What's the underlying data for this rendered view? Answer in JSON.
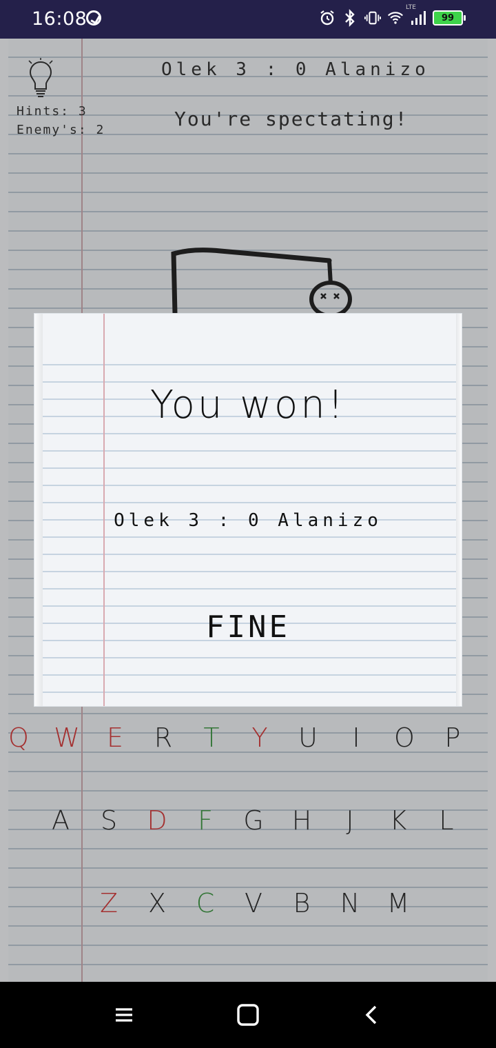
{
  "status_bar": {
    "time": "16:08",
    "network_label": "LTE",
    "battery_level": "99",
    "icons": [
      "alarm-icon",
      "bluetooth-icon",
      "vibrate-icon",
      "wifi-icon",
      "signal-icon",
      "battery-icon"
    ]
  },
  "game": {
    "score_line": "Olek 3 : 0 Alanizo",
    "status_line": "You're spectating!",
    "hints_line": "Hints: 3",
    "enemy_hints_line": "Enemy's: 2"
  },
  "keyboard": {
    "rows": [
      [
        {
          "letter": "Q",
          "state": "wrong"
        },
        {
          "letter": "W",
          "state": "wrong"
        },
        {
          "letter": "E",
          "state": "wrong"
        },
        {
          "letter": "R",
          "state": "unused"
        },
        {
          "letter": "T",
          "state": "right"
        },
        {
          "letter": "Y",
          "state": "wrong"
        },
        {
          "letter": "U",
          "state": "unused"
        },
        {
          "letter": "I",
          "state": "unused"
        },
        {
          "letter": "O",
          "state": "unused"
        },
        {
          "letter": "P",
          "state": "unused"
        }
      ],
      [
        {
          "letter": "A",
          "state": "unused"
        },
        {
          "letter": "S",
          "state": "unused"
        },
        {
          "letter": "D",
          "state": "wrong"
        },
        {
          "letter": "F",
          "state": "right"
        },
        {
          "letter": "G",
          "state": "unused"
        },
        {
          "letter": "H",
          "state": "unused"
        },
        {
          "letter": "J",
          "state": "unused"
        },
        {
          "letter": "K",
          "state": "unused"
        },
        {
          "letter": "L",
          "state": "unused"
        }
      ],
      [
        {
          "letter": "Z",
          "state": "wrong"
        },
        {
          "letter": "X",
          "state": "unused"
        },
        {
          "letter": "C",
          "state": "right"
        },
        {
          "letter": "V",
          "state": "unused"
        },
        {
          "letter": "B",
          "state": "unused"
        },
        {
          "letter": "N",
          "state": "unused"
        },
        {
          "letter": "M",
          "state": "unused"
        }
      ]
    ]
  },
  "dialog": {
    "title": "You won!",
    "score_line": "Olek 3 : 0 Alanizo",
    "button_label": "FINE"
  },
  "colors": {
    "wrong_letter": "#d12b2b",
    "right_letter": "#2f8f34",
    "status_bar_bg": "#24204a"
  }
}
